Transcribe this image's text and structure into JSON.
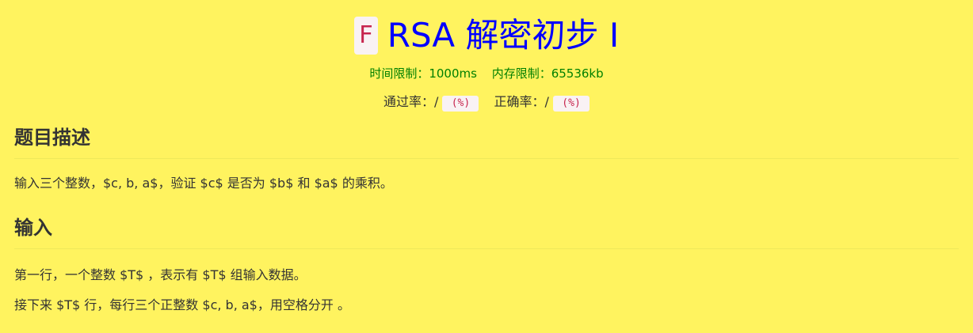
{
  "header": {
    "problem_code": "F",
    "title": "RSA 解密初步 Ⅰ",
    "time_limit": "时间限制：1000ms",
    "memory_limit": "内存限制：65536kb"
  },
  "rates": {
    "pass_label": "通过率：/",
    "pass_value": "(%)",
    "correct_label": "正确率：/",
    "correct_value": "(%)"
  },
  "description": {
    "heading": "题目描述",
    "text": "输入三个整数，$c, b, a$，验证 $c$ 是否为 $b$ 和 $a$ 的乘积。"
  },
  "input": {
    "heading": "输入",
    "line1": "第一行，一个整数 $T$ ，表示有 $T$ 组输入数据。",
    "line2": "接下来 $T$ 行，每行三个正整数 $c, b, a$，用空格分开 。"
  },
  "colors": {
    "background": "#fff35f",
    "title": "#0000ff",
    "limits": "#008000",
    "code": "#c7254e"
  }
}
